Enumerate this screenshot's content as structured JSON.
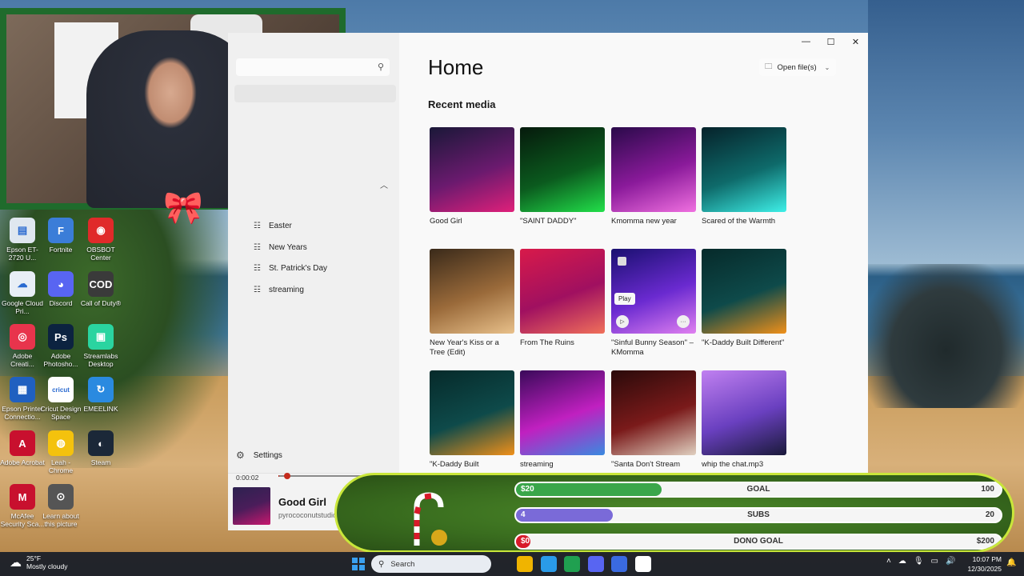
{
  "desktop": {
    "icons": [
      {
        "label": "Epson ET-2720 U...",
        "color": "#dfe7ef",
        "glyph": "▤"
      },
      {
        "label": "Fortnite",
        "color": "#3b7dd8",
        "glyph": "F"
      },
      {
        "label": "OBSBOT Center",
        "color": "#e02a2a",
        "glyph": "◉"
      },
      {
        "label": "Google Cloud Pri...",
        "color": "#e8eef6",
        "glyph": "☁"
      },
      {
        "label": "Discord",
        "color": "#5865f2",
        "glyph": "◕"
      },
      {
        "label": "Call of Duty®",
        "color": "#3a3a3a",
        "glyph": "COD"
      },
      {
        "label": "Adobe Creati...",
        "color": "#e8344c",
        "glyph": "◎"
      },
      {
        "label": "Adobe Photosho...",
        "color": "#0c2340",
        "glyph": "Ps"
      },
      {
        "label": "Streamlabs Desktop",
        "color": "#2ad4a0",
        "glyph": "▣"
      },
      {
        "label": "Epson Printer Connectio...",
        "color": "#2060c0",
        "glyph": "▦"
      },
      {
        "label": "Cricut Design Space",
        "color": "#ffffff",
        "glyph": "cricut"
      },
      {
        "label": "EMEELINK",
        "color": "#2a8ae0",
        "glyph": "↻"
      },
      {
        "label": "Adobe Acrobat",
        "color": "#c8102e",
        "glyph": "A"
      },
      {
        "label": "Leah - Chrome",
        "color": "#f4c20d",
        "glyph": "◍"
      },
      {
        "label": "Steam",
        "color": "#1b2838",
        "glyph": "◐"
      },
      {
        "label": "McAfee Security Sca...",
        "color": "#c8102e",
        "glyph": "M"
      },
      {
        "label": "Learn about this picture",
        "color": "#555555",
        "glyph": "⊙"
      }
    ]
  },
  "player": {
    "title": "Home",
    "open_files_label": "Open file(s)",
    "section_title": "Recent media",
    "playlists": [
      "Easter",
      "New Years",
      "St. Patrick's Day",
      "streaming"
    ],
    "settings_label": "Settings",
    "tooltip_play": "Play",
    "media": [
      {
        "title": "Good Girl",
        "colors": [
          "#1a1838",
          "#6a1a6e",
          "#e0207a"
        ]
      },
      {
        "title": "\"SAINT DADDY\"",
        "colors": [
          "#061a0c",
          "#0b5a1e",
          "#22e04a"
        ]
      },
      {
        "title": "Kmomma new year",
        "colors": [
          "#2a0a4a",
          "#8a1a9a",
          "#f070e0"
        ]
      },
      {
        "title": "Scared of the Warmth",
        "colors": [
          "#06222a",
          "#0e6a6a",
          "#3ef0e8"
        ]
      },
      {
        "title": "New Year's Kiss or a Tree (Edit)",
        "colors": [
          "#3a2a1a",
          "#9a6a3a",
          "#e8c08a"
        ]
      },
      {
        "title": "From The Ruins",
        "colors": [
          "#d81a4a",
          "#a01060",
          "#f0705a"
        ]
      },
      {
        "title": "\"Sinful Bunny Season\" – KMomma",
        "colors": [
          "#1a1070",
          "#6a2ad0",
          "#e080f0"
        ]
      },
      {
        "title": "\"K-Daddy Built Different\"",
        "colors": [
          "#062a2a",
          "#0e4a4a",
          "#f0901a"
        ]
      },
      {
        "title": "\"K-Daddy Built",
        "colors": [
          "#062a2a",
          "#0e4a4a",
          "#f0901a"
        ]
      },
      {
        "title": "streaming",
        "colors": [
          "#3a0a5a",
          "#c020c0",
          "#3a8ae0"
        ]
      },
      {
        "title": "\"Santa Don't Stream",
        "colors": [
          "#2a0a0a",
          "#7a1a1a",
          "#e0d0c0"
        ]
      },
      {
        "title": "whip the chat.mp3",
        "colors": [
          "#c080f0",
          "#6a40c0",
          "#1a1a3a"
        ]
      }
    ],
    "now_playing": {
      "time": "0:00:02",
      "title": "Good Girl",
      "artist": "pyrococonutstudio",
      "progress": 0.01
    }
  },
  "goals": [
    {
      "start": "$20",
      "label": "GOAL",
      "end": "100",
      "fill": 0.3,
      "color": "#3aa64a"
    },
    {
      "start": "4",
      "label": "SUBS",
      "end": "20",
      "fill": 0.2,
      "color": "#7a6ad8"
    },
    {
      "start": "$0",
      "label": "DONO GOAL",
      "end": "$200",
      "fill": 0.03,
      "color": "#d81a2a"
    }
  ],
  "taskbar": {
    "weather_temp": "25°F",
    "weather_desc": "Mostly cloudy",
    "search_placeholder": "Search",
    "time": "10:07 PM",
    "date": "12/30/2025",
    "apps": [
      "#f0b400",
      "#2a9be8",
      "#20a050",
      "#5865f2",
      "#3a6ae0",
      "#ffffff"
    ]
  }
}
